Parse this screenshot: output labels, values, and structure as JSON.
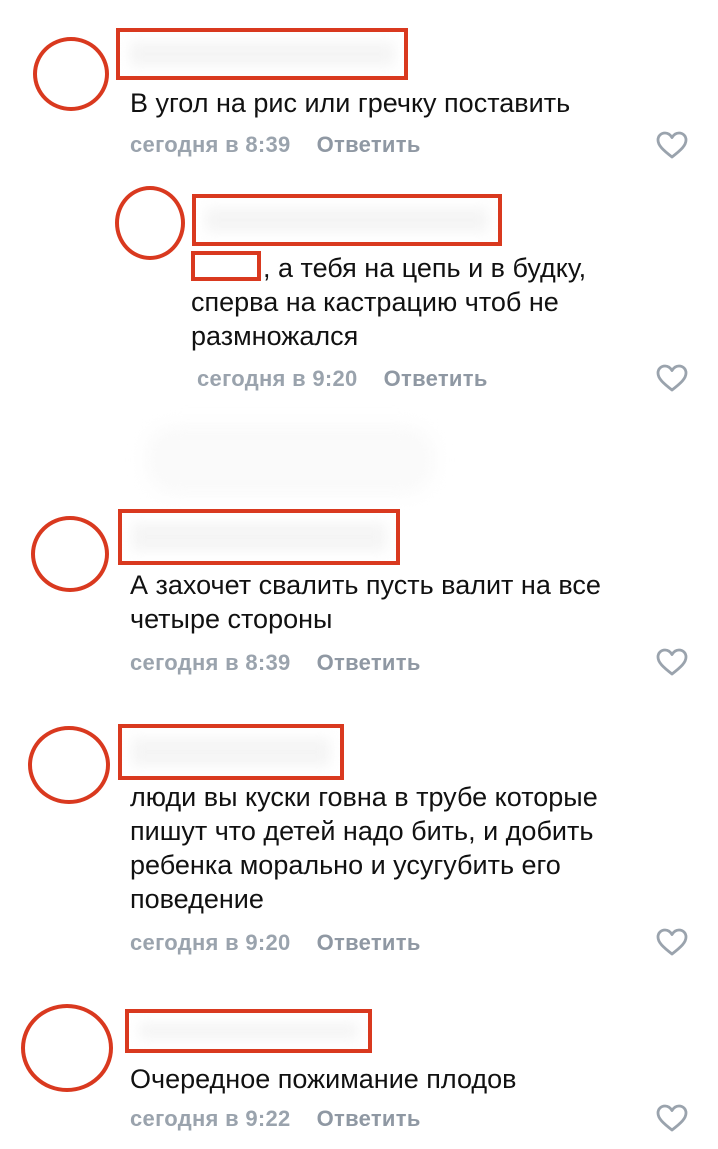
{
  "comments": [
    {
      "text": "В угол на рис или гречку поставить",
      "time": "сегодня в 8:39",
      "reply_label": "Ответить"
    },
    {
      "text": ", а тебя на цепь и в будку, сперва на кастрацию чтоб не размножался",
      "time": "сегодня в 9:20",
      "reply_label": "Ответить"
    },
    {
      "text": "А захочет свалить пусть валит на все четыре стороны",
      "time": "сегодня в 8:39",
      "reply_label": "Ответить"
    },
    {
      "text": "люди вы куски говна в трубе которые пишут что детей надо бить, и добить ребенка морально и усугубить его поведение",
      "time": "сегодня в 9:20",
      "reply_label": "Ответить"
    },
    {
      "text": "Очередное пожимание плодов",
      "time": "сегодня в 9:22",
      "reply_label": "Ответить"
    }
  ],
  "colors": {
    "annotation": "#d9391f",
    "meta": "#9aa3ad",
    "text": "#111111"
  },
  "icons": {
    "like": "heart-outline-icon"
  }
}
